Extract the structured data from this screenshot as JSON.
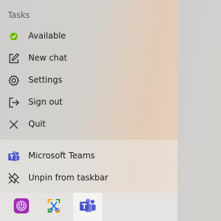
{
  "menu": {
    "section_title": "Tasks",
    "items": [
      {
        "label": "Available",
        "icon": "status-available-icon"
      },
      {
        "label": "New chat",
        "icon": "compose-icon"
      },
      {
        "label": "Settings",
        "icon": "gear-icon"
      },
      {
        "label": "Sign out",
        "icon": "sign-out-icon"
      },
      {
        "label": "Quit",
        "icon": "close-icon"
      }
    ]
  },
  "pinned": {
    "items": [
      {
        "label": "Microsoft Teams",
        "icon": "teams-icon"
      },
      {
        "label": "Unpin from taskbar",
        "icon": "unpin-icon"
      }
    ]
  },
  "taskbar": {
    "apps": [
      {
        "icon": "power-app-icon"
      },
      {
        "icon": "snip-tool-icon"
      },
      {
        "icon": "teams-icon"
      }
    ]
  },
  "colors": {
    "available_green": "#6bb700",
    "teams_purple": "#5059c9",
    "power_purple": "#9b2fae"
  }
}
